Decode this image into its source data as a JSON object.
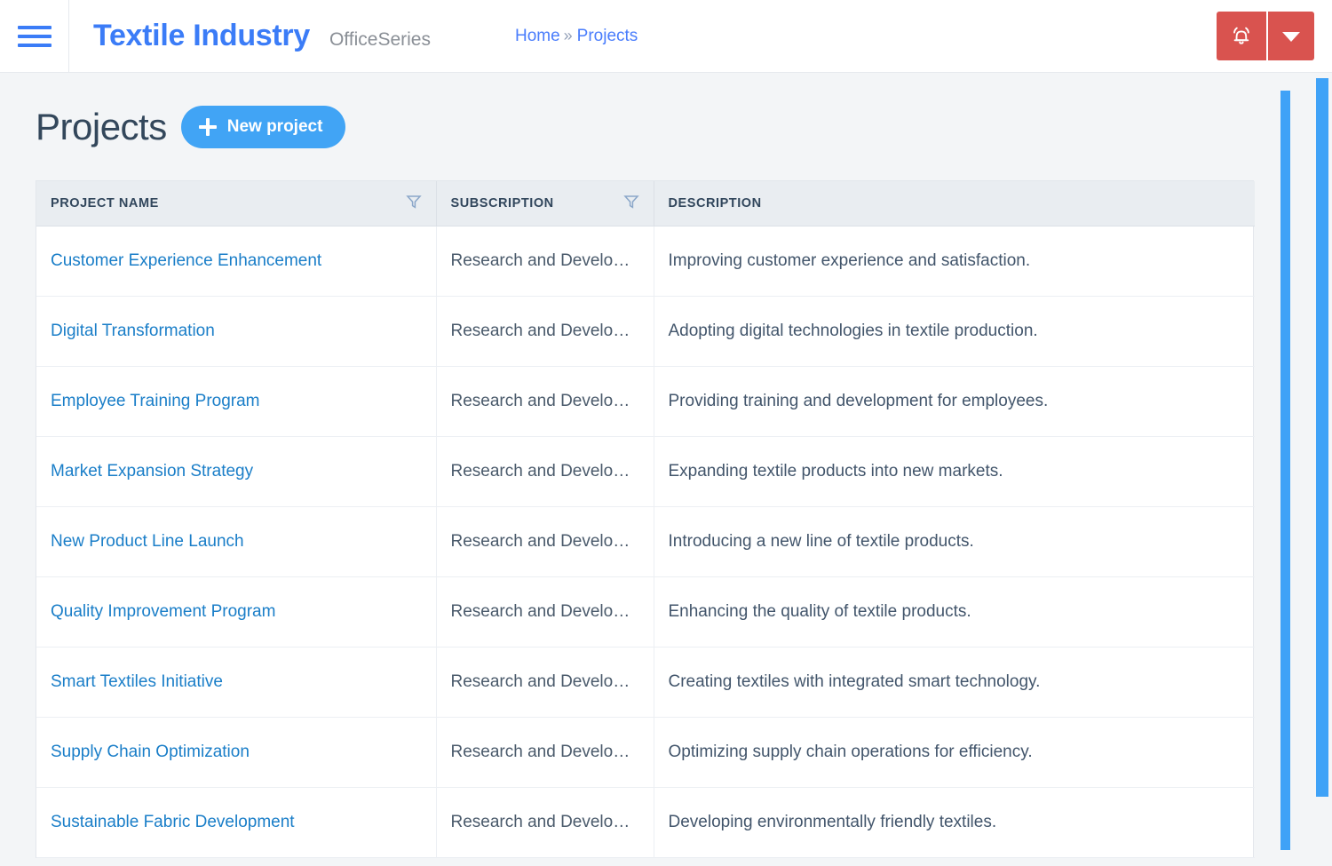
{
  "topbar": {
    "menu_icon": "hamburger-menu-icon",
    "brand_title": "Textile Industry",
    "brand_subtitle": "OfficeSeries",
    "breadcrumb": {
      "home_label": "Home",
      "separator": "»",
      "current_label": "Projects"
    },
    "actions": {
      "notification_icon": "alarm-bell-icon",
      "dropdown_icon": "caret-down-icon",
      "button_color": "#d9534f"
    }
  },
  "page": {
    "title": "Projects",
    "new_project_label": "New project",
    "new_project_icon": "plus-icon",
    "accent_color": "#41a4f5",
    "link_color": "#1a7ec8"
  },
  "table": {
    "columns": [
      {
        "label": "PROJECT NAME",
        "filter_icon": "funnel-filter-icon",
        "filterable": true
      },
      {
        "label": "SUBSCRIPTION",
        "filter_icon": "funnel-filter-icon",
        "filterable": true
      },
      {
        "label": "DESCRIPTION",
        "filterable": false
      }
    ],
    "rows": [
      {
        "name": "Customer Experience Enhancement",
        "subscription": "Research and Develop…",
        "description": "Improving customer experience and satisfaction."
      },
      {
        "name": "Digital Transformation",
        "subscription": "Research and Develop…",
        "description": "Adopting digital technologies in textile production."
      },
      {
        "name": "Employee Training Program",
        "subscription": "Research and Develop…",
        "description": "Providing training and development for employees."
      },
      {
        "name": "Market Expansion Strategy",
        "subscription": "Research and Develop…",
        "description": "Expanding textile products into new markets."
      },
      {
        "name": "New Product Line Launch",
        "subscription": "Research and Develop…",
        "description": "Introducing a new line of textile products."
      },
      {
        "name": "Quality Improvement Program",
        "subscription": "Research and Develop…",
        "description": "Enhancing the quality of textile products."
      },
      {
        "name": "Smart Textiles Initiative",
        "subscription": "Research and Develop…",
        "description": "Creating textiles with integrated smart technology."
      },
      {
        "name": "Supply Chain Optimization",
        "subscription": "Research and Develop…",
        "description": "Optimizing supply chain operations for efficiency."
      },
      {
        "name": "Sustainable Fabric Development",
        "subscription": "Research and Develop…",
        "description": "Developing environmentally friendly textiles."
      }
    ]
  },
  "scrollbars": {
    "inner": {
      "name": "table-vertical-scrollbar",
      "color": "#3fa2f7"
    },
    "outer": {
      "name": "page-vertical-scrollbar",
      "color": "#3fa2f7"
    }
  }
}
